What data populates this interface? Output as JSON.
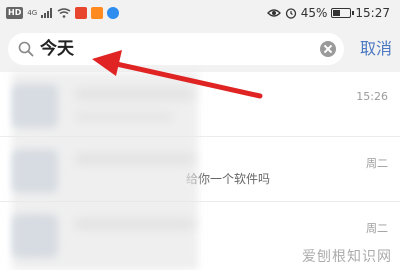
{
  "status_bar": {
    "hd_label": "HD",
    "network_label": "4G",
    "battery": "45%",
    "battery_level": 0.45,
    "time": "15:27"
  },
  "search": {
    "query": "今天",
    "cancel_label": "取消"
  },
  "results": [
    {
      "time": "15:26",
      "message": ""
    },
    {
      "time": "周二",
      "message": "给你一个软件吗"
    },
    {
      "time": "周二",
      "message": ""
    }
  ],
  "watermark": "爱刨根知识网",
  "colors": {
    "accent": "#4a78c2",
    "arrow": "#e02424"
  }
}
